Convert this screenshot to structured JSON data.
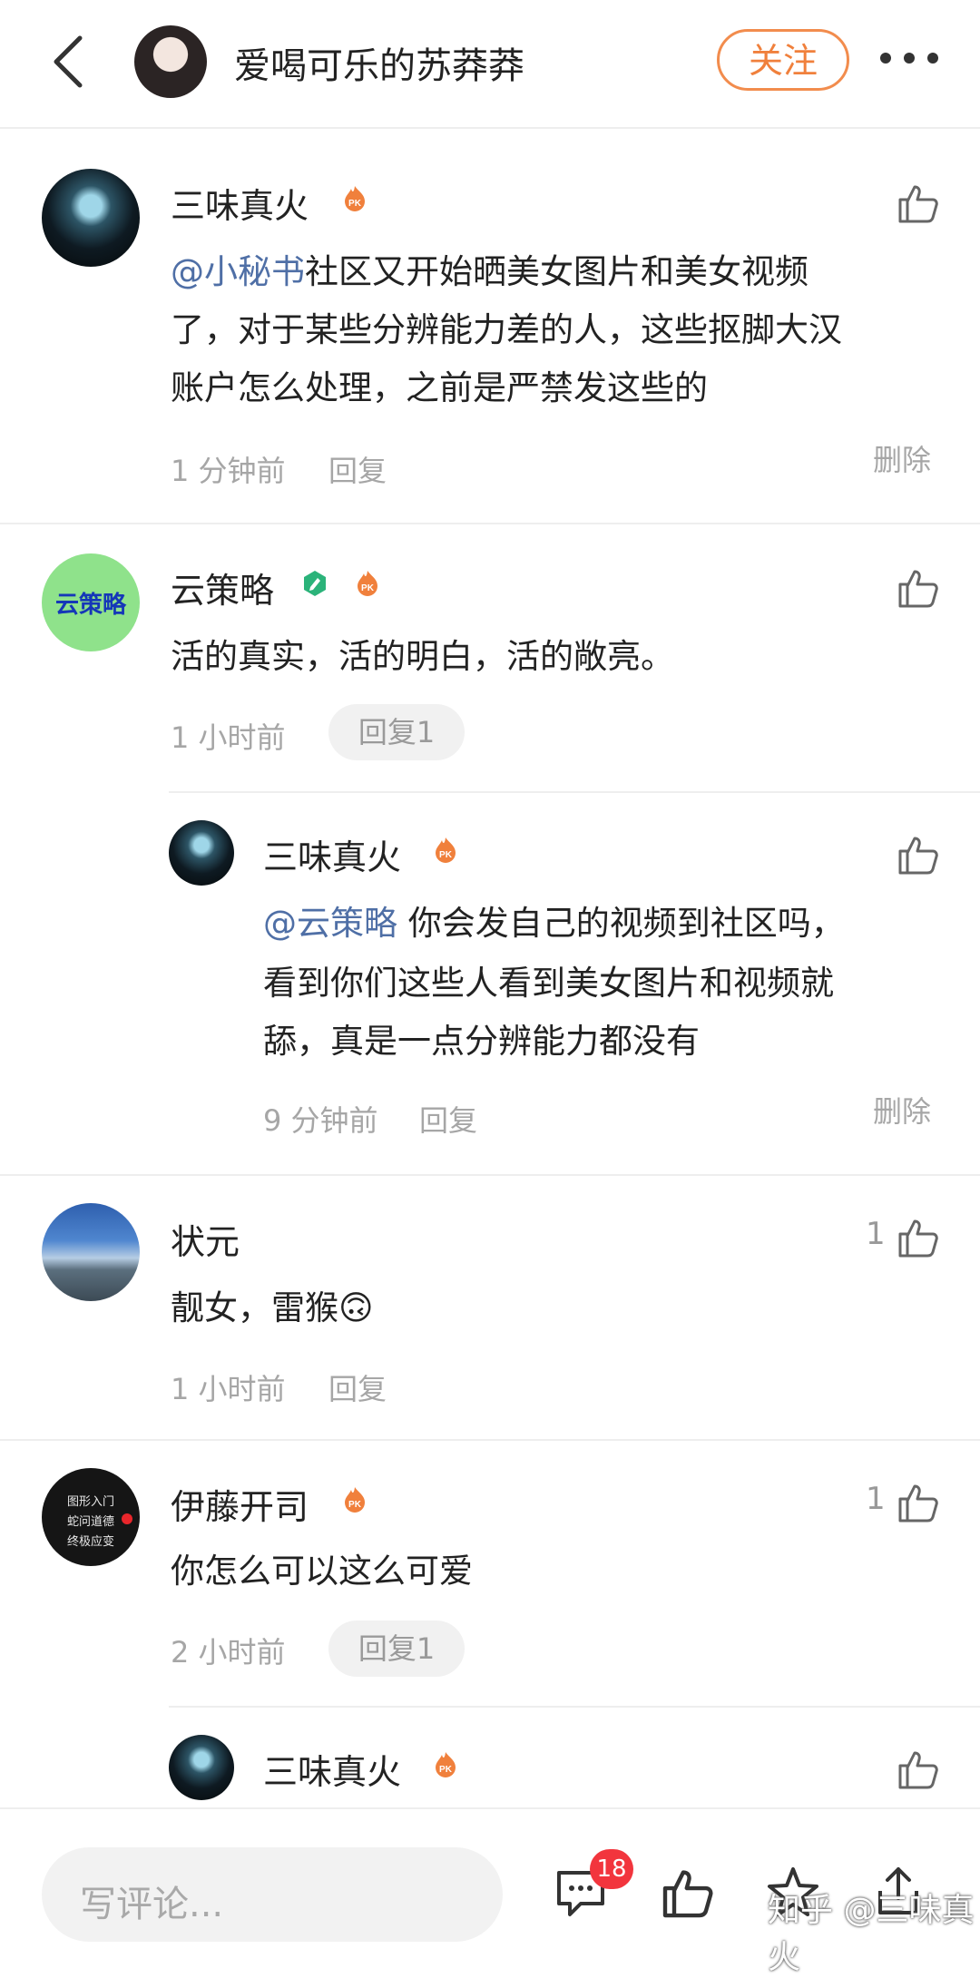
{
  "header": {
    "title": "爱喝可乐的苏莽莽",
    "follow_label": "关注"
  },
  "comments": [
    {
      "user": "三味真火",
      "mention": "@小秘书",
      "lines": [
        "社区又开始晒美女图片和美女视频",
        "了，对于某些分辨能力差的人，这些抠脚大汉",
        "账户怎么处理，之前是严禁发这些的"
      ],
      "time": "1 分钟前",
      "reply": "回复",
      "delete": "删除"
    },
    {
      "user": "云策略",
      "avatar_text": "云策略",
      "text": "活的真实，活的明白，活的敞亮。",
      "time": "1 小时前",
      "reply": "回复1",
      "sub_reply": {
        "user": "三味真火",
        "mention": "@云策略",
        "lines": [
          " 你会发自己的视频到社区吗，",
          "看到你们这些人看到美女图片和视频就",
          "舔，真是一点分辨能力都没有"
        ],
        "time": "9 分钟前",
        "reply": "回复",
        "delete": "删除"
      }
    },
    {
      "user": "状元",
      "text": "靓女，雷猴🙃",
      "time": "1 小时前",
      "reply": "回复",
      "likes": "1"
    },
    {
      "user": "伊藤开司",
      "avatar_lines": [
        "图形入门",
        "蛇问道德",
        "终极应变"
      ],
      "text": "你怎么可以这么可爱",
      "time": "2 小时前",
      "reply": "回复1",
      "likes": "1",
      "sub_reply": {
        "user": "三味真火"
      }
    }
  ],
  "bottom": {
    "placeholder": "写评论...",
    "comment_count": "18",
    "watermark": "知乎 @三味真火"
  },
  "colors": {
    "accent": "#f0803c",
    "mention": "#4f6fa6",
    "badge_red": "#f2353d"
  }
}
